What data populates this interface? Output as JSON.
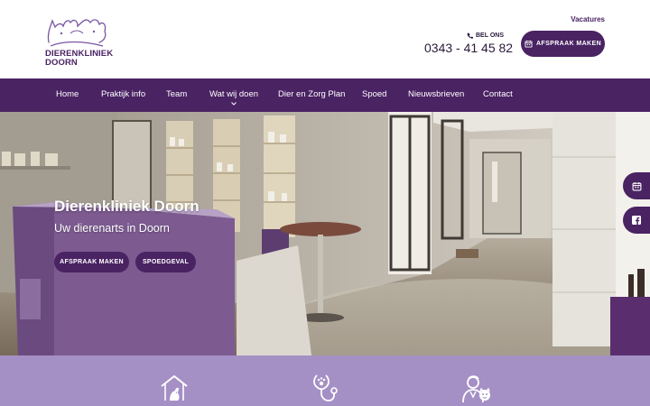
{
  "header": {
    "logo": {
      "line1": "DIERENKLINIEK",
      "line2": "DOORN"
    },
    "vacatures_label": "Vacatures",
    "bel_ons_label": "BEL ONS",
    "phone": "0343 - 41 45 82",
    "appointment_button": "AFSPRAAK MAKEN"
  },
  "nav": {
    "items": [
      {
        "label": "Home"
      },
      {
        "label": "Praktijk info"
      },
      {
        "label": "Team"
      },
      {
        "label": "Wat wij doen"
      },
      {
        "label": "Dier en Zorg Plan"
      },
      {
        "label": "Spoed"
      },
      {
        "label": "Nieuwsbrieven"
      },
      {
        "label": "Contact"
      }
    ]
  },
  "hero": {
    "title": "Dierenkliniek Doorn",
    "subtitle": "Uw dierenarts in Doorn",
    "buttons": [
      {
        "label": "AFSPRAAK MAKEN"
      },
      {
        "label": "SPOEDGEVAL"
      }
    ]
  },
  "side_tabs": [
    {
      "icon": "calendar-icon"
    },
    {
      "icon": "facebook-icon"
    }
  ],
  "features": [
    {
      "icon": "house-pet-icon"
    },
    {
      "icon": "stethoscope-paw-icon"
    },
    {
      "icon": "veterinarian-icon"
    }
  ],
  "colors": {
    "brand": "#4a2363",
    "features_bg": "#a590c5",
    "white": "#ffffff"
  }
}
